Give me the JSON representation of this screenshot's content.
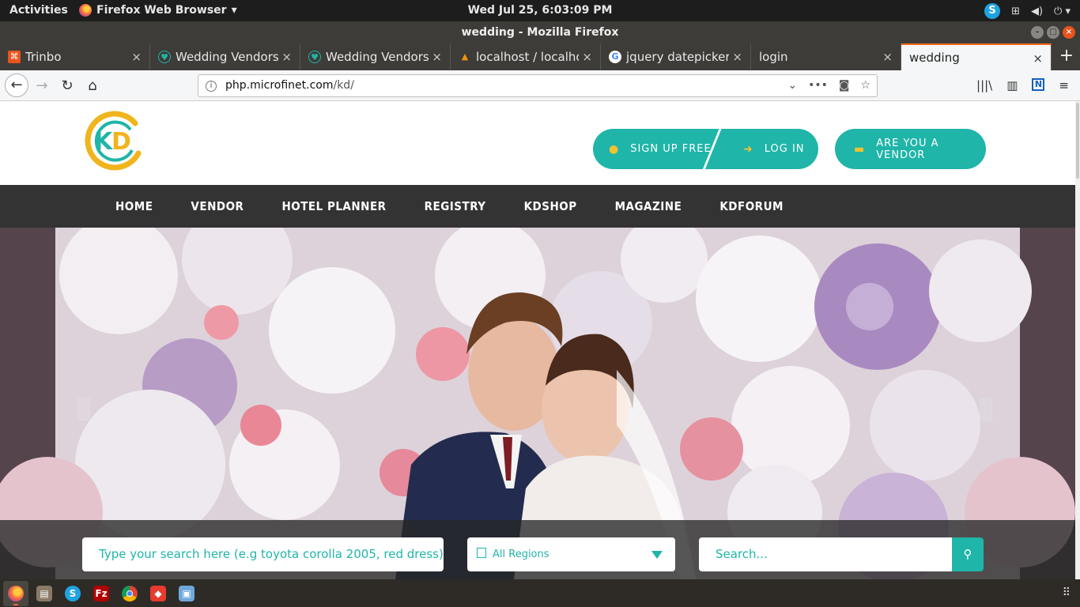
{
  "topbar": {
    "activities": "Activities",
    "app_menu": "Firefox Web Browser",
    "clock": "Wed Jul 25,  6:03:09 PM"
  },
  "window": {
    "title": "wedding - Mozilla Firefox"
  },
  "tabs": [
    {
      "label": "Trinbo",
      "icon": "trinbo-icon",
      "color": "#e8541d"
    },
    {
      "label": "Wedding Vendors",
      "icon": "wedding-icon",
      "color": "#1fb5a8"
    },
    {
      "label": "Wedding Vendors",
      "icon": "wedding-icon",
      "color": "#1fb5a8"
    },
    {
      "label": "localhost / localhos",
      "icon": "phpmyadmin-icon",
      "color": "#f29111"
    },
    {
      "label": "jquery datepicker f",
      "icon": "google-icon",
      "color": "#4285f4"
    },
    {
      "label": "login",
      "icon": "",
      "color": ""
    },
    {
      "label": "wedding",
      "icon": "",
      "color": ""
    }
  ],
  "url": {
    "host": "php.microfinet.com",
    "path": "/kd/"
  },
  "header": {
    "signup_label": "SIGN UP FREE",
    "login_label": "LOG IN",
    "vendor_label": "ARE YOU A VENDOR",
    "accent": "#1fb5a8"
  },
  "nav": [
    "HOME",
    "VENDOR",
    "HOTEL PLANNER",
    "REGISTRY",
    "KDSHOP",
    "MAGAZINE",
    "KDFORUM"
  ],
  "search": {
    "main_placeholder": "Type your search here (e.g toyota corolla 2005, red dress)",
    "region_value": "All Regions",
    "search_placeholder": "Search..."
  }
}
